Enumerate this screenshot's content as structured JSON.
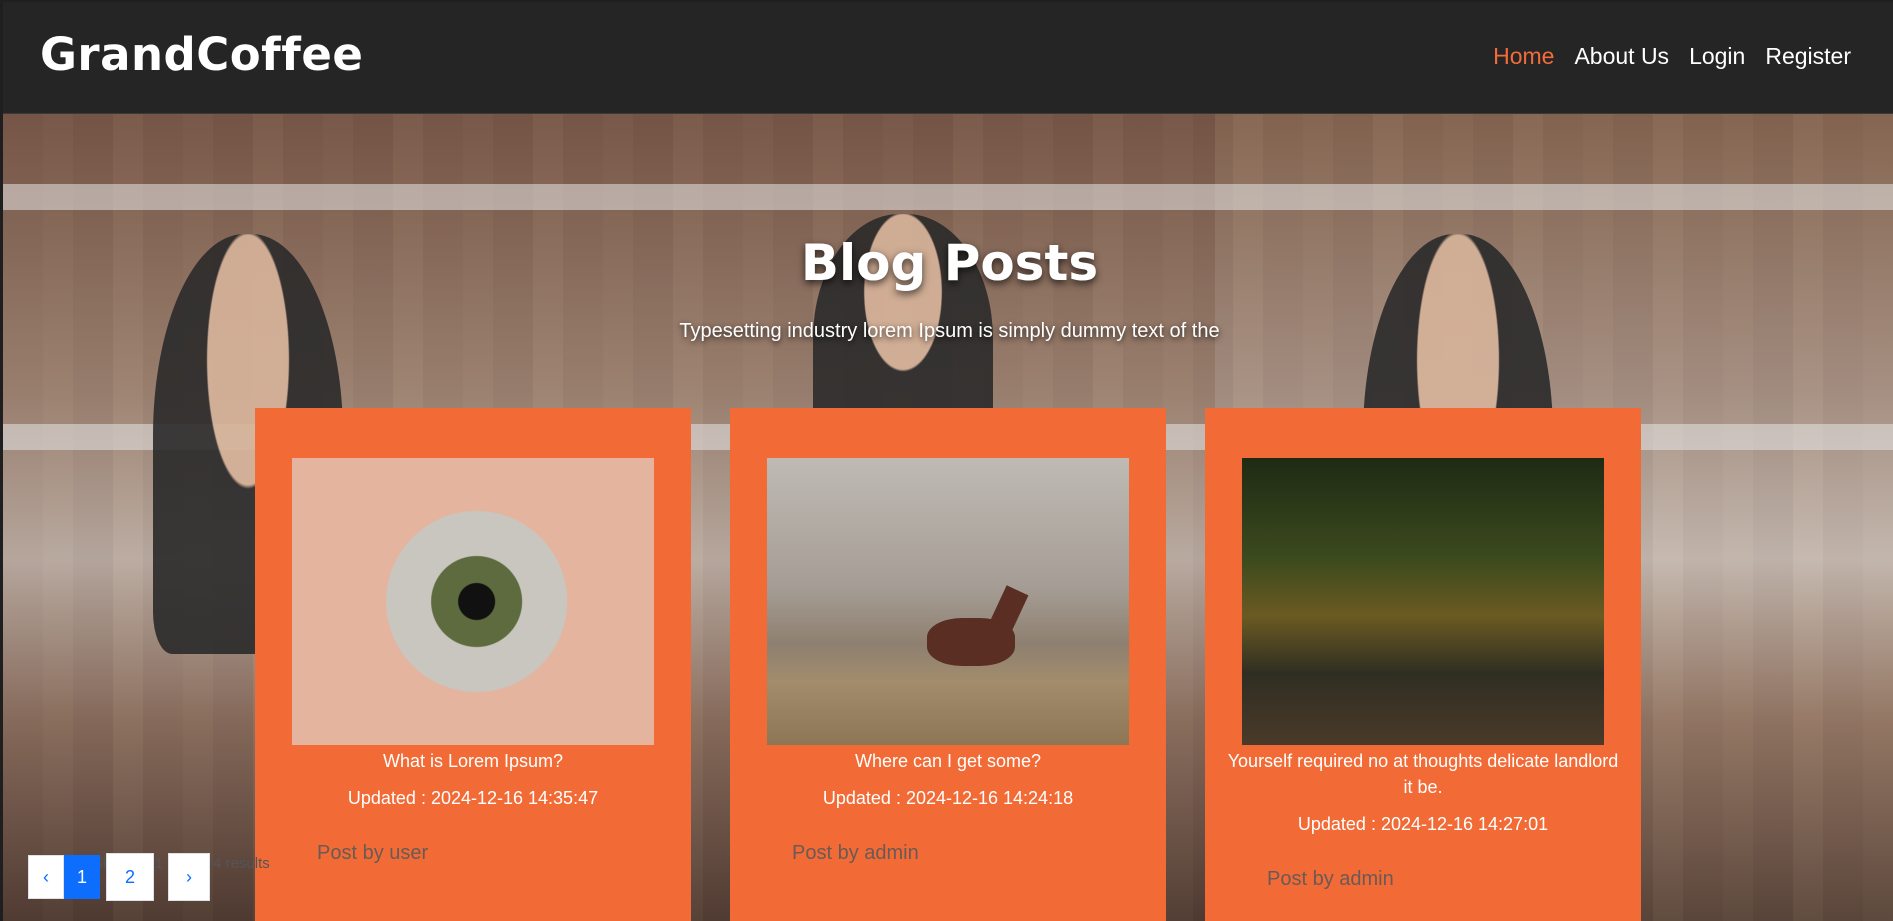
{
  "brand": "GrandCoffee",
  "nav": [
    {
      "label": "Home",
      "active": true
    },
    {
      "label": "About Us",
      "active": false
    },
    {
      "label": "Login",
      "active": false
    },
    {
      "label": "Register",
      "active": false
    }
  ],
  "hero": {
    "title": "Blog Posts",
    "subtitle": "Typesetting industry lorem Ipsum is simply dummy text of the"
  },
  "posts": [
    {
      "title": "What is Lorem Ipsum?",
      "updated": "Updated : 2024-12-16 14:35:47",
      "post_by_label": "Post by",
      "author": "user",
      "image": "eye-closeup-image"
    },
    {
      "title": "Where can I get some?",
      "updated": "Updated : 2024-12-16 14:24:18",
      "post_by_label": "Post by",
      "author": "admin",
      "image": "horse-image"
    },
    {
      "title": "Yourself required no at thoughts delicate landlord it be.",
      "updated": "Updated : 2024-12-16 14:27:01",
      "post_by_label": "Post by",
      "author": "admin",
      "image": "forest-path-image"
    }
  ],
  "pagination": {
    "prev": "‹",
    "pages": [
      "1",
      "2"
    ],
    "active": "1",
    "next": "›",
    "results_text": "Showing 1 to 3 of 4 results"
  },
  "colors": {
    "accent": "#f26b36",
    "nav_active": "#f26b3a",
    "header_bg": "#252525",
    "pagination_active": "#0d6efd"
  }
}
